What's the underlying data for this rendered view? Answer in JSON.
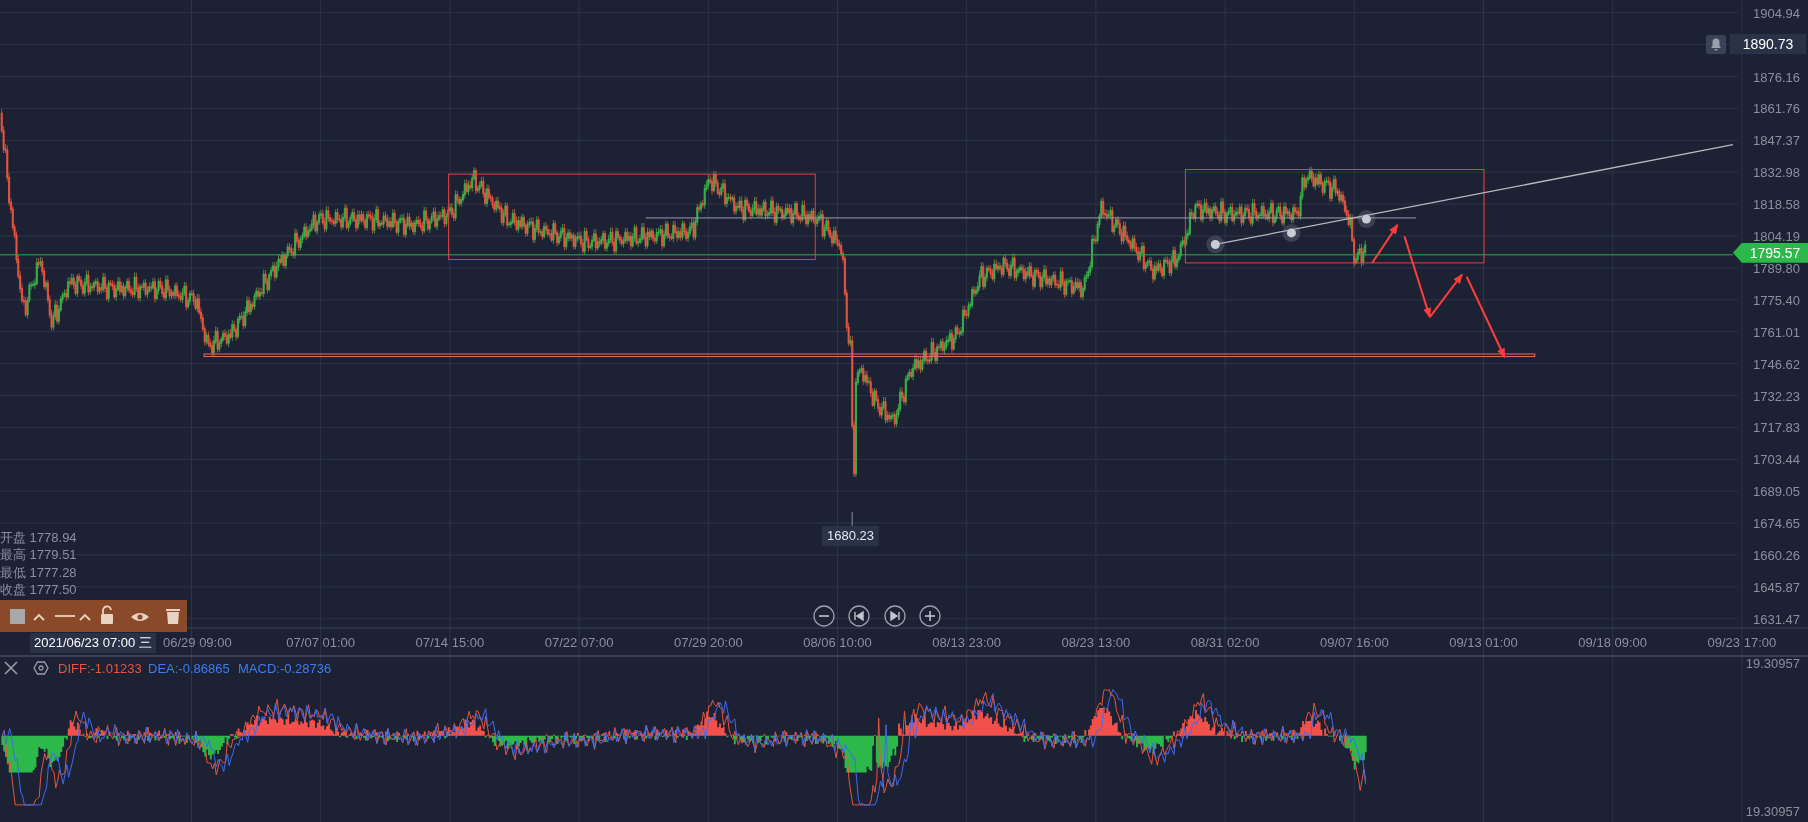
{
  "price_axis": {
    "ticks": [
      "1904.94",
      "1876.16",
      "1861.76",
      "1847.37",
      "1832.98",
      "1818.58",
      "1804.19",
      "1789.80",
      "1775.40",
      "1761.01",
      "1746.62",
      "1732.23",
      "1717.83",
      "1703.44",
      "1689.05",
      "1674.65",
      "1660.26",
      "1645.87",
      "1631.47"
    ]
  },
  "alert": {
    "price": "1890.73"
  },
  "current_price": {
    "label": "1795.57"
  },
  "low_marker": {
    "label": "1680.23"
  },
  "ohlc": [
    {
      "label": "开盘",
      "value": "1778.94"
    },
    {
      "label": "最高",
      "value": "1779.51"
    },
    {
      "label": "最低",
      "value": "1777.28"
    },
    {
      "label": "收盘",
      "value": "1777.50"
    }
  ],
  "time_axis": {
    "crosshair_label": "2021/06/23 07:00 三",
    "ticks": [
      "06/29 09:00",
      "07/07 01:00",
      "07/14 15:00",
      "07/22 07:00",
      "07/29 20:00",
      "08/06 10:00",
      "08/13 23:00",
      "08/23 13:00",
      "08/31 02:00",
      "09/07 16:00",
      "09/13 01:00",
      "09/18 09:00",
      "09/23 17:00"
    ]
  },
  "macd": {
    "diff": "DIFF:-1.01233",
    "dea": "DEA:-0.86865",
    "macd": "MACD:-0.28736",
    "top_value": "19.30957",
    "bottom_value": "19.30957"
  }
}
